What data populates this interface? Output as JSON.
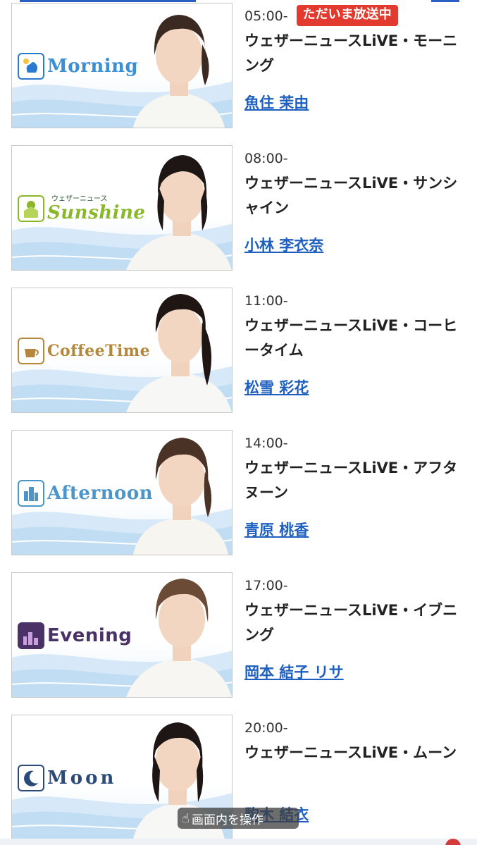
{
  "live_badge": "ただいま放送中",
  "operation_bar": "画面内を操作",
  "programs": [
    {
      "time": "05:00-",
      "title": "ウェザーニュースLiVE・モーニング",
      "anchor": "魚住 茉由",
      "logo": "Morning",
      "logo_color": "#3a8fd6"
    },
    {
      "time": "08:00-",
      "title": "ウェザーニュースLiVE・サンシャイン",
      "anchor": "小林 李衣奈",
      "logo": "Sunshine",
      "logo_sub": "ウェザーニュース",
      "logo_color": "#8ab82a"
    },
    {
      "time": "11:00-",
      "title": "ウェザーニュースLiVE・コーヒータイム",
      "anchor": "松雪 彩花",
      "logo": "CoffeeTime",
      "logo_color": "#b5873c"
    },
    {
      "time": "14:00-",
      "title": "ウェザーニュースLiVE・アフタヌーン",
      "anchor": "青原 桃香",
      "logo": "Afternoon",
      "logo_color": "#4a95c9"
    },
    {
      "time": "17:00-",
      "title": "ウェザーニュースLiVE・イブニング",
      "anchor": "岡本 結子 リサ",
      "logo": "Evening",
      "logo_color": "#4a3266"
    },
    {
      "time": "20:00-",
      "title": "ウェザーニュースLiVE・ムーン",
      "anchor": "駒木 結衣",
      "logo": "Moon",
      "logo_color": "#2a4a7a"
    }
  ]
}
